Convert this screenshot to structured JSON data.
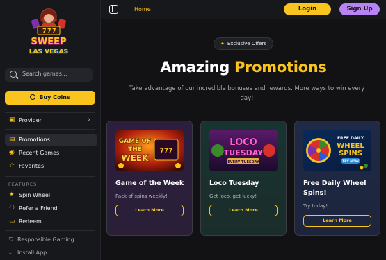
{
  "brand": {
    "logo_top": "SWEEP",
    "logo_bottom": "LAS VEGAS"
  },
  "search": {
    "placeholder": "Search games..."
  },
  "sidebar": {
    "buy_label": "Buy Coins",
    "provider_label": "Provider",
    "items": [
      {
        "label": "Promotions",
        "active": true
      },
      {
        "label": "Recent Games",
        "active": false
      },
      {
        "label": "Favorites",
        "active": false
      }
    ],
    "features_heading": "FEATURES",
    "features": [
      {
        "label": "Spin Wheel"
      },
      {
        "label": "Refer a Friend"
      },
      {
        "label": "Redeem"
      }
    ],
    "footer": [
      {
        "label": "Responsible Gaming"
      },
      {
        "label": "Install App"
      }
    ]
  },
  "topbar": {
    "home_label": "Home",
    "login_label": "Login",
    "signup_label": "Sign Up"
  },
  "main": {
    "badge": "Exclusive Offers",
    "heading_part1": "Amazing",
    "heading_part2": "Promotions",
    "subtitle": "Take advantage of our incredible bonuses and rewards. More ways to win every day!",
    "cards": [
      {
        "title": "Game of the Week",
        "desc": "Pack of spins weekly!",
        "button": "Learn More",
        "img_line1": "GAME OF",
        "img_line2": "THE",
        "img_line3": "WEEK"
      },
      {
        "title": "Loco Tuesday",
        "desc": "Get loco, get lucky!",
        "button": "Learn More",
        "img_line1": "LOCO",
        "img_line2": "TUESDAY",
        "img_line3": "EVERY TUESDAY"
      },
      {
        "title": "Free Daily Wheel Spins!",
        "desc": "Try today!",
        "button": "Learn More",
        "img_line1": "FREE DAILY",
        "img_line2": "WHEEL",
        "img_line3": "SPINS",
        "img_line4": "TRY NOW"
      }
    ]
  },
  "colors": {
    "accent": "#f8c41d",
    "signup": "#b884f2",
    "background": "#121214",
    "sidebar": "#17181c"
  }
}
